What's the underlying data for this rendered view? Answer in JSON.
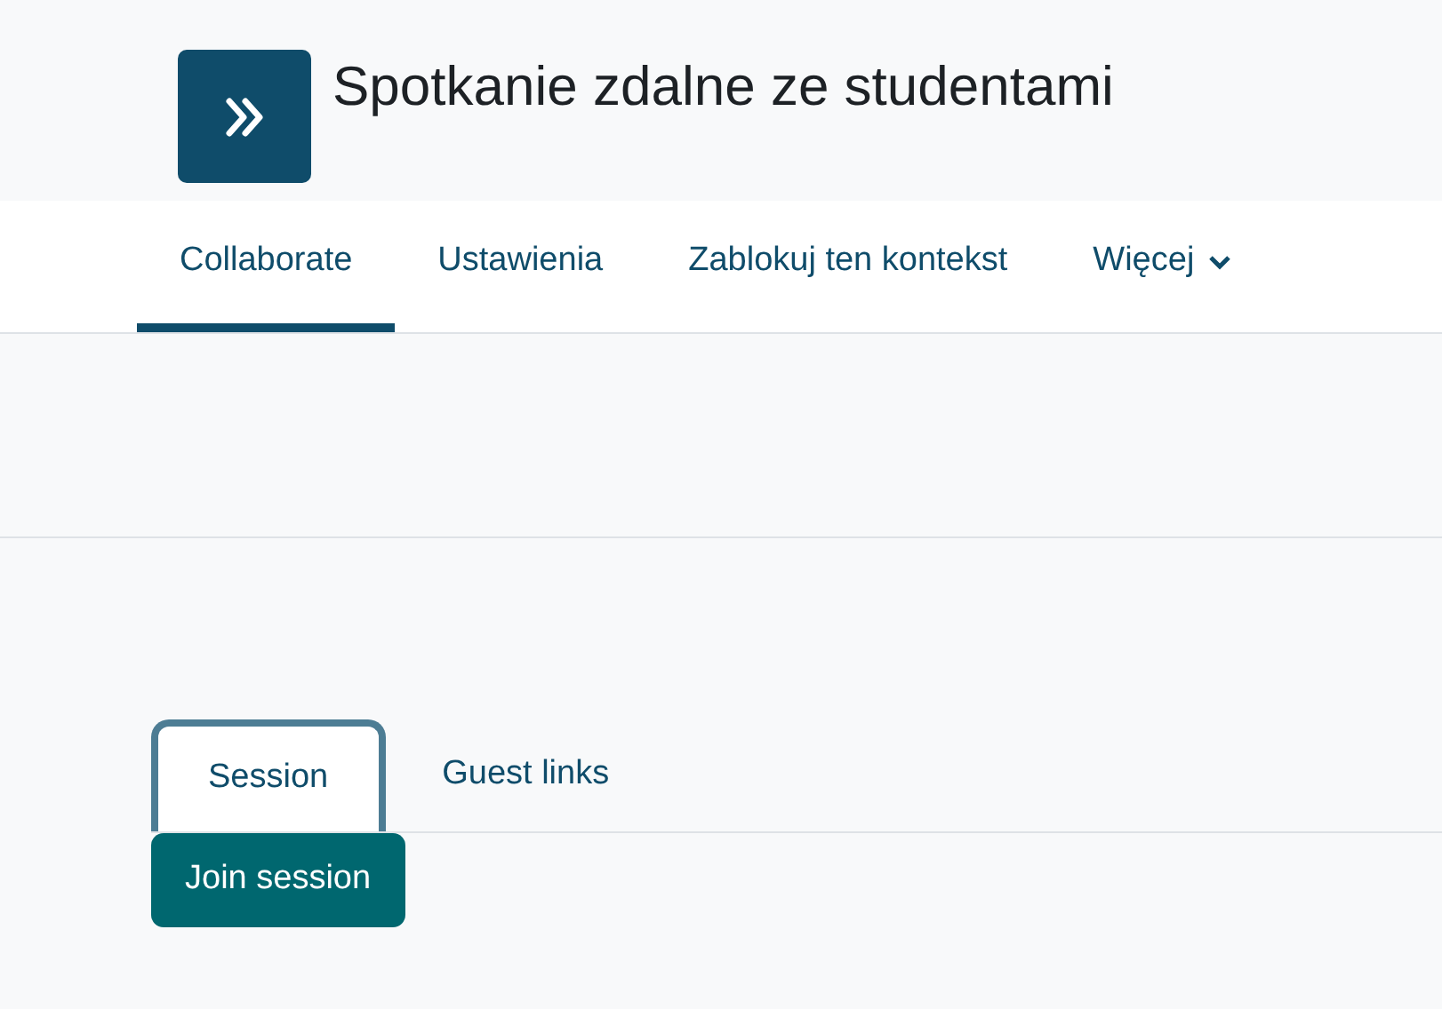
{
  "page_title": "Spotkanie zdalne ze studentami",
  "nav": [
    {
      "label": "Collaborate",
      "selected": true,
      "kind": "link"
    },
    {
      "label": "Ustawienia",
      "selected": false,
      "kind": "link"
    },
    {
      "label": "Zablokuj ten kontekst",
      "selected": false,
      "kind": "link"
    },
    {
      "label": "Więcej",
      "selected": false,
      "kind": "dropdown"
    }
  ],
  "tabs": [
    {
      "label": "Session",
      "selected": true
    },
    {
      "label": "Guest links",
      "selected": false
    }
  ],
  "join_button": "Join session"
}
